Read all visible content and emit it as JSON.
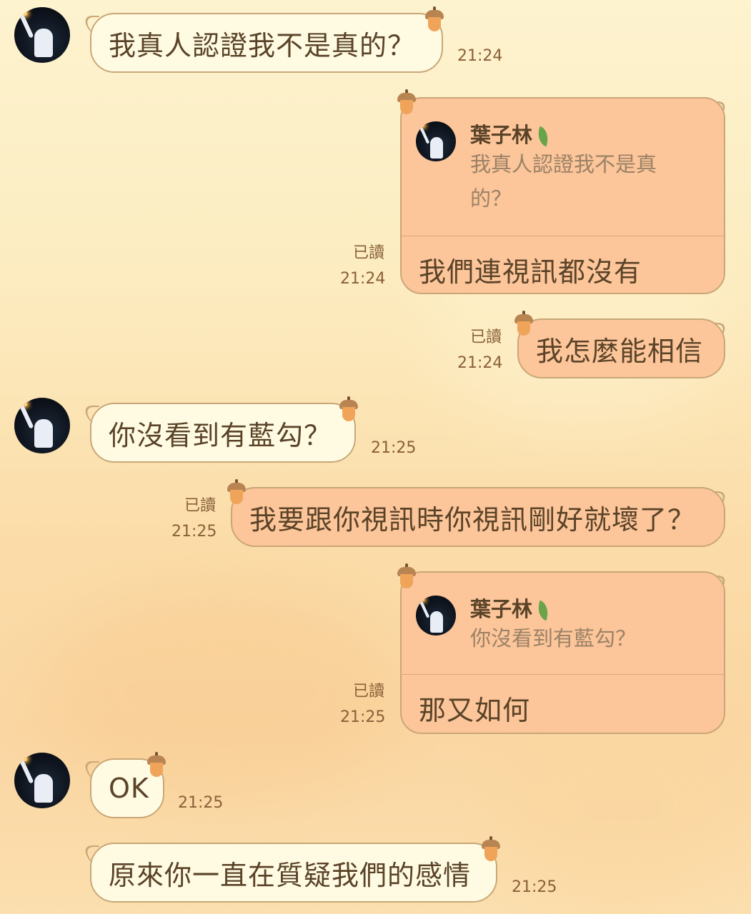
{
  "colors": {
    "incoming_bubble": "#fffbe3",
    "outgoing_bubble": "#fcc59a",
    "bubble_border": "#c9a778",
    "text": "#5a4328",
    "timestamp": "#8a6038"
  },
  "messages": [
    {
      "side": "in",
      "text": "我真人認證我不是真的？",
      "time": "21:24"
    },
    {
      "side": "out",
      "reply_to": {
        "name": "葉子林",
        "text": "我真人認證我不是真的？"
      },
      "text": "我們連視訊都沒有",
      "read": "已讀",
      "time": "21:24"
    },
    {
      "side": "out",
      "text": "我怎麼能相信",
      "read": "已讀",
      "time": "21:24"
    },
    {
      "side": "in",
      "text": "你沒看到有藍勾？",
      "time": "21:25"
    },
    {
      "side": "out",
      "text": "我要跟你視訊時你視訊剛好就壞了？",
      "read": "已讀",
      "time": "21:25"
    },
    {
      "side": "out",
      "reply_to": {
        "name": "葉子林",
        "text": "你沒看到有藍勾？"
      },
      "text": "那又如何",
      "read": "已讀",
      "time": "21:25"
    },
    {
      "side": "in",
      "text": "OK",
      "time": "21:25"
    },
    {
      "side": "in",
      "text": "原來你一直在質疑我們的感情",
      "time": "21:25"
    }
  ]
}
